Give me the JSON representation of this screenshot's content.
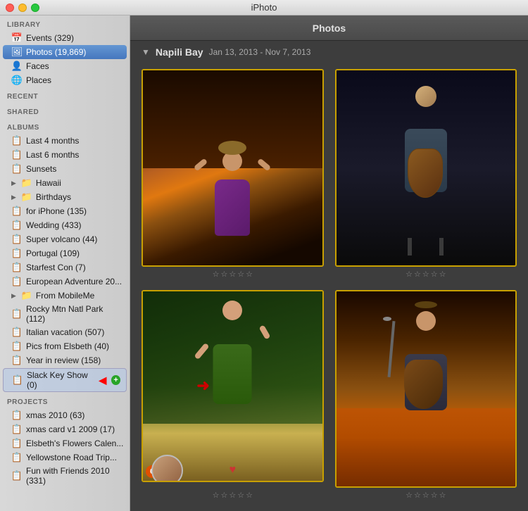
{
  "window": {
    "title": "iPhoto",
    "content_title": "Photos"
  },
  "sidebar": {
    "library_header": "Library",
    "recent_header": "Recent",
    "shared_header": "Shared",
    "albums_header": "Albums",
    "projects_header": "Projects",
    "library_items": [
      {
        "id": "events",
        "label": "Events (329)",
        "icon": "📅"
      },
      {
        "id": "photos",
        "label": "Photos (19,869)",
        "icon": "🖼",
        "selected": true
      },
      {
        "id": "faces",
        "label": "Faces",
        "icon": "👤"
      },
      {
        "id": "places",
        "label": "Places",
        "icon": "🌐"
      }
    ],
    "album_items": [
      {
        "id": "last4",
        "label": "Last 4 months",
        "icon": "📋"
      },
      {
        "id": "last6",
        "label": "Last 6 months",
        "icon": "📋"
      },
      {
        "id": "sunsets",
        "label": "Sunsets",
        "icon": "📋"
      },
      {
        "id": "hawaii",
        "label": "Hawaii",
        "icon": "📁",
        "expandable": true
      },
      {
        "id": "birthdays",
        "label": "Birthdays",
        "icon": "📁",
        "expandable": true
      },
      {
        "id": "foriphone",
        "label": "for iPhone (135)",
        "icon": "📋"
      },
      {
        "id": "wedding",
        "label": "Wedding (433)",
        "icon": "📋"
      },
      {
        "id": "supervolcano",
        "label": "Super volcano (44)",
        "icon": "📋"
      },
      {
        "id": "portugal",
        "label": "Portugal (109)",
        "icon": "📋"
      },
      {
        "id": "starfestcon",
        "label": "Starfest Con (7)",
        "icon": "📋"
      },
      {
        "id": "european",
        "label": "European Adventure 20...",
        "icon": "📋"
      },
      {
        "id": "frommobileme",
        "label": "From MobileMe",
        "icon": "📁",
        "expandable": true
      },
      {
        "id": "rockymtn",
        "label": "Rocky Mtn Natl Park (112)",
        "icon": "📋"
      },
      {
        "id": "italianvacation",
        "label": "Italian vacation (507)",
        "icon": "📋"
      },
      {
        "id": "picsfromelsbeth",
        "label": "Pics from Elsbeth (40)",
        "icon": "📋"
      },
      {
        "id": "yearinreview",
        "label": "Year in review (158)",
        "icon": "📋"
      },
      {
        "id": "slackkeyshow",
        "label": "Slack Key Show (0)",
        "icon": "📋",
        "highlight": true,
        "plus": true
      }
    ],
    "project_items": [
      {
        "id": "xmas2010",
        "label": "xmas 2010 (63)",
        "icon": "📋"
      },
      {
        "id": "xmascard",
        "label": "xmas card v1 2009 (17)",
        "icon": "📋"
      },
      {
        "id": "elsbethflowers",
        "label": "Elsbeth's Flowers Calen...",
        "icon": "📋"
      },
      {
        "id": "yellowstone",
        "label": "Yellowstone Road Trip...",
        "icon": "📋"
      },
      {
        "id": "funwithfriends",
        "label": "Fun with Friends 2010 (331)",
        "icon": "📋"
      }
    ]
  },
  "album": {
    "name": "Napili Bay",
    "date_range": "Jan 13, 2013 - Nov 7, 2013"
  },
  "photos": [
    {
      "id": "p1",
      "stars": [
        0,
        0,
        0,
        0,
        0
      ]
    },
    {
      "id": "p2",
      "stars": [
        0,
        0,
        0,
        0,
        0
      ]
    },
    {
      "id": "p3",
      "stars": [
        0,
        0,
        0,
        0,
        0
      ],
      "heart": true,
      "badge": "6"
    },
    {
      "id": "p4",
      "stars": [
        0,
        0,
        0,
        0,
        0
      ]
    }
  ],
  "stars_empty": "☆☆☆☆☆"
}
